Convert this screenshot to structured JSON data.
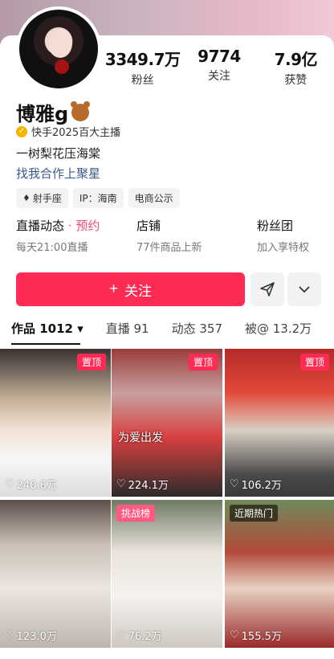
{
  "profile": {
    "stats": [
      {
        "value": "3349.7万",
        "label": "粉丝"
      },
      {
        "value": "9774",
        "label": "关注"
      },
      {
        "value": "7.9亿",
        "label": "获赞"
      }
    ],
    "name": "博雅g",
    "verified_text": "快手2025百大主播",
    "bio": "一树梨花压海棠",
    "cooperation_link": "找我合作上聚星",
    "tags": [
      {
        "icon": "♦",
        "label": "射手座"
      },
      {
        "icon": "",
        "label": "IP：海南"
      },
      {
        "icon": "",
        "label": "电商公示"
      }
    ]
  },
  "entries": [
    {
      "title": "直播动态",
      "extra": "· 预约",
      "sub": "每天21:00直播"
    },
    {
      "title": "店铺",
      "extra": "",
      "sub": "77件商品上新"
    },
    {
      "title": "粉丝团",
      "extra": "",
      "sub": "加入享特权"
    }
  ],
  "actions": {
    "follow_label": "关注",
    "plus": "+"
  },
  "tabs": [
    {
      "label": "作品 1012 ▾"
    },
    {
      "label": "直播 91"
    },
    {
      "label": "动态 357"
    },
    {
      "label": "被@ 13.2万"
    }
  ],
  "videos": [
    {
      "badge": "置顶",
      "likes": "240.6万"
    },
    {
      "badge": "置顶",
      "likes": "224.1万",
      "caption": "为爱出发"
    },
    {
      "badge": "置顶",
      "likes": "106.2万"
    },
    {
      "badge": "",
      "likes": "123.0万"
    },
    {
      "badge": "挑战榜",
      "likes": "76.2万"
    },
    {
      "badge": "近期热门",
      "likes": "155.5万"
    }
  ],
  "colors": {
    "accent": "#fe2c55",
    "link": "#3a5a8f",
    "pink_text": "#ee4a7a"
  }
}
